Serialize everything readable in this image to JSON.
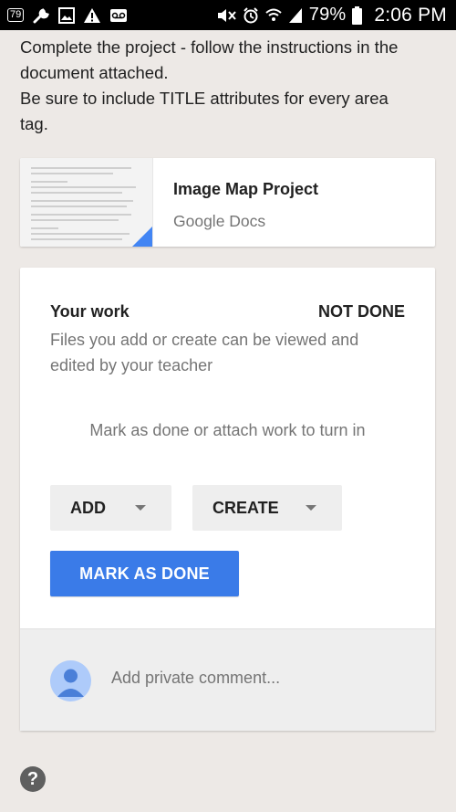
{
  "status_bar": {
    "badge": "79",
    "battery": "79%",
    "time": "2:06 PM"
  },
  "instructions": {
    "line1": "Complete the project - follow the instructions in the",
    "line2": "document attached.",
    "line3": "Be sure to include TITLE attributes for every area",
    "line4": "tag."
  },
  "attachment": {
    "title": "Image Map Project",
    "source": "Google Docs"
  },
  "work": {
    "heading": "Your work",
    "status": "NOT DONE",
    "description": "Files you add or create can be viewed and edited by your teacher",
    "hint": "Mark as done or attach work to turn in",
    "add_label": "ADD",
    "create_label": "CREATE",
    "mark_done_label": "MARK AS DONE"
  },
  "comment": {
    "placeholder": "Add private comment..."
  },
  "help": {
    "label": "?"
  },
  "colors": {
    "accent": "#3a7be8",
    "doc_corner": "#4285f4",
    "avatar_bg": "#aecbfa",
    "avatar_fg": "#4a7fd8"
  }
}
